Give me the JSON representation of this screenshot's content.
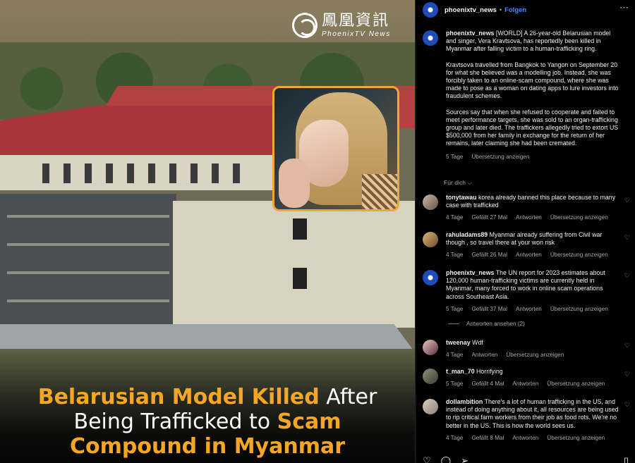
{
  "image": {
    "logo_zh": "鳳凰資訊",
    "logo_en": "PhoenixTV News",
    "headline": {
      "a": "Belarusian Model Killed",
      "b": " After",
      "c": "Being Trafficked to ",
      "d": "Scam",
      "e": "Compound in Myanmar"
    },
    "accent_color": "#f5a623"
  },
  "header": {
    "username": "phoenixtv_news",
    "dot": "•",
    "follow_label": "Folgen",
    "more_icon": "⋯"
  },
  "caption": {
    "username": "phoenixtv_news",
    "p1": "[WORLD] A 26-year-old Belarusian model and singer, Vera Kravtsova, has reportedly been killed in Myanmar after falling victim to a human-trafficking ring.",
    "p2": "Kravtsova travelled from Bangkok to Yangon on September 20 for what she believed was a modelling job. Instead, she was forcibly taken to an online-scam compound, where she was made to pose as a woman on dating apps to lure investors into fraudulent schemes.",
    "p3": "Sources say that when she refused to cooperate and failed to meet performance targets, she was sold to an organ-trafficking group and later died. The traffickers allegedly tried to extort US $500,000 from her family in exchange for the return of her remains, later claiming she had been cremated.",
    "time": "5 Tage",
    "translate": "Übersetzung anzeigen"
  },
  "see_all": "Für dich ⌵",
  "comments": [
    {
      "username": "tonytawau",
      "text": "korea already banned this place because to many case with trafficked",
      "time": "4 Tage",
      "likes": "Gefällt 27 Mal",
      "reply": "Antworten",
      "translate": "Übersetzung anzeigen"
    },
    {
      "username": "rahuladams89",
      "text": "Myanmar already suffering from Civil war though , so travel there at your won risk",
      "time": "4 Tage",
      "likes": "Gefällt 26 Mal",
      "reply": "Antworten",
      "translate": "Übersetzung anzeigen"
    },
    {
      "username": "phoenixtv_news",
      "text": "The UN report for 2023 estimates about 120,000 human-trafficking victims are currently held in Myanmar, many forced to work in online scam operations across Southeast Asia.",
      "time": "5 Tage",
      "likes": "Gefällt 37 Mal",
      "reply": "Antworten",
      "translate": "Übersetzung anzeigen",
      "view_replies": "Antworten ansehen (2)"
    },
    {
      "username": "tweenay",
      "text": "Wdf",
      "time": "4 Tage",
      "reply": "Antworten",
      "translate": "Übersetzung anzeigen"
    },
    {
      "username": "t_man_70",
      "text": "Horrifying",
      "time": "5 Tage",
      "likes": "Gefällt 4 Mal",
      "reply": "Antworten",
      "translate": "Übersetzung anzeigen"
    },
    {
      "username": "dollambition",
      "text": "There's a lot of human trafficking in the US, and instead of doing anything about it, all resources are being used to rip critical farm workers from their job as food rots. We're no better in the US. This is how the world sees us.",
      "time": "4 Tage",
      "likes": "Gefällt 8 Mal",
      "reply": "Antworten",
      "translate": "Übersetzung anzeigen"
    }
  ],
  "icons": {
    "heart": "♡",
    "like_action": "♡",
    "comment_action": "◯",
    "share_action": "➢",
    "save_action": "▯"
  }
}
